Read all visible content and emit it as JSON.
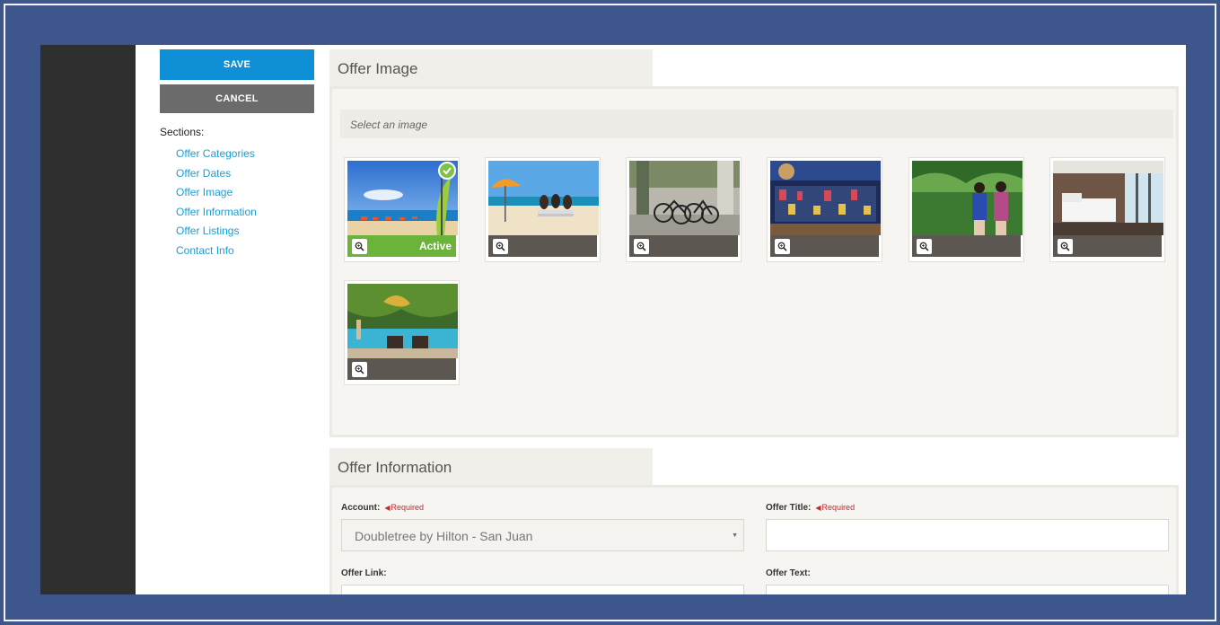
{
  "toolbar": {
    "save_label": "SAVE",
    "cancel_label": "CANCEL"
  },
  "sidebar": {
    "sections_label": "Sections:",
    "links": [
      "Offer Categories",
      "Offer Dates",
      "Offer Image",
      "Offer Information",
      "Offer Listings",
      "Contact Info"
    ]
  },
  "offer_image": {
    "title": "Offer Image",
    "select_text": "Select an image",
    "active_label": "Active",
    "thumbnails": [
      "beach-umbrellas-photo",
      "beach-friends-photo",
      "bicycles-photo",
      "store-interior-photo",
      "friends-palm-trees-photo",
      "hotel-room-photo",
      "pool-garden-photo"
    ]
  },
  "offer_information": {
    "title": "Offer Information",
    "account_label": "Account:",
    "account_value": "Doubletree by Hilton - San Juan",
    "offer_title_label": "Offer Title:",
    "offer_link_label": "Offer Link:",
    "offer_text_label": "Offer Text:",
    "required_text": "Required"
  },
  "colors": {
    "frame": "#3d578c",
    "save": "#0f8fd6",
    "cancel": "#6b6b6b",
    "link": "#1b9ed6",
    "active": "#6bb33b",
    "required": "#c1272d"
  }
}
